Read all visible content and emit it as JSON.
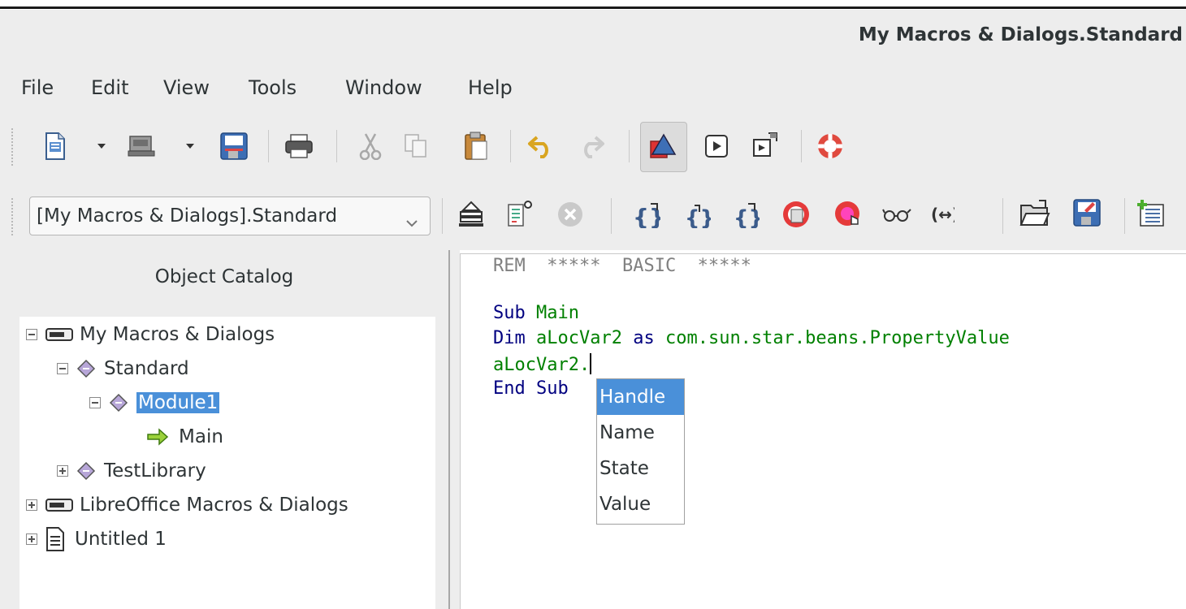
{
  "window": {
    "title": "My Macros & Dialogs.Standard"
  },
  "menu": [
    {
      "label": "File"
    },
    {
      "label": "Edit"
    },
    {
      "label": "View"
    },
    {
      "label": "Tools"
    },
    {
      "label": "Window"
    },
    {
      "label": "Help"
    }
  ],
  "library_select": {
    "value": "[My Macros & Dialogs].Standard"
  },
  "object_catalog": {
    "title": "Object Catalog",
    "tree": [
      {
        "label": "My Macros & Dialogs"
      },
      {
        "label": "Standard"
      },
      {
        "label": "Module1"
      },
      {
        "label": "Main"
      },
      {
        "label": "TestLibrary"
      },
      {
        "label": "LibreOffice Macros & Dialogs"
      },
      {
        "label": "Untitled 1"
      }
    ]
  },
  "editor": {
    "rem_kw": "REM",
    "rem_text": "*****  BASIC  *****",
    "sub_kw": "Sub",
    "sub_name": "Main",
    "dim_kw": "Dim",
    "dim_var": "aLocVar2",
    "as_kw": "as",
    "dim_type": "com.sun.star.beans.PropertyValue",
    "typing": "aLocVar2.",
    "end_kw": "End Sub"
  },
  "autocomplete": {
    "items": [
      {
        "label": "Handle"
      },
      {
        "label": "Name"
      },
      {
        "label": "State"
      },
      {
        "label": "Value"
      }
    ],
    "selected": "Handle"
  },
  "colors": {
    "selection": "#4a90d9",
    "keyword": "#000080",
    "identifier": "#008000",
    "comment": "#808080"
  }
}
